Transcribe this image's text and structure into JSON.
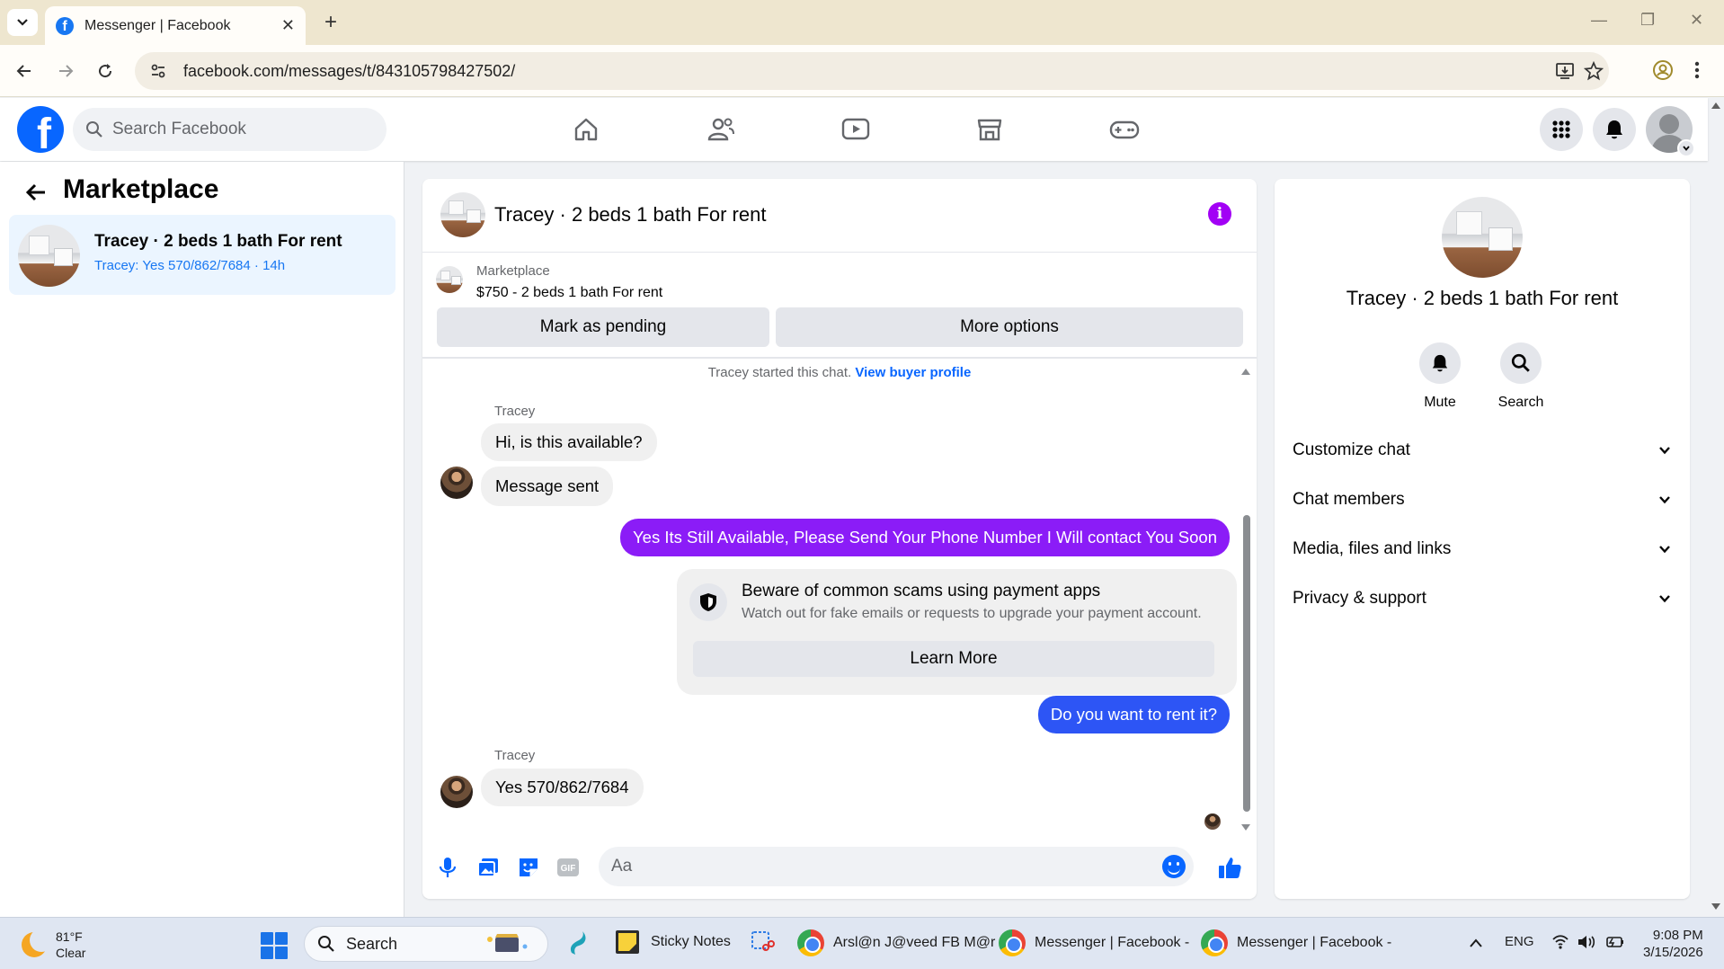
{
  "browser": {
    "tab_title": "Messenger | Facebook",
    "url": "facebook.com/messages/t/843105798427502/"
  },
  "fb_nav": {
    "search_placeholder": "Search Facebook"
  },
  "sidebar": {
    "title": "Marketplace",
    "conversation": {
      "title": "Tracey · 2 beds 1 bath For rent",
      "preview": "Tracey: Yes 570/862/7684 · 14h"
    }
  },
  "chat": {
    "title": "Tracey · 2 beds 1 bath For rent",
    "marketplace_label": "Marketplace",
    "listing_price": "$750 - 2 beds 1 bath For rent",
    "mark_pending_label": "Mark as pending",
    "more_options_label": "More options",
    "started_text": "Tracey started this chat.",
    "view_profile_label": "View buyer profile",
    "messages": [
      {
        "sender": "Tracey",
        "text": "Hi, is this available?"
      },
      {
        "text": "Message sent"
      },
      {
        "text": "Yes Its Still Available, Please Send Your Phone Number I Will contact You Soon"
      },
      {
        "text": "Do you want to rent it?"
      },
      {
        "sender": "Tracey",
        "text": "Yes 570/862/7684"
      }
    ],
    "scam_warning": {
      "title": "Beware of common scams using payment apps",
      "text": "Watch out for fake emails or requests to upgrade your payment account.",
      "button": "Learn More"
    },
    "composer_placeholder": "Aa",
    "gif_label": "GIF"
  },
  "info_panel": {
    "title": "Tracey · 2 beds 1 bath For rent",
    "actions": [
      {
        "label": "Mute",
        "icon": "bell-icon"
      },
      {
        "label": "Search",
        "icon": "search-icon"
      }
    ],
    "sections": [
      "Customize chat",
      "Chat members",
      "Media, files and links",
      "Privacy & support"
    ]
  },
  "taskbar": {
    "weather_temp": "81°F",
    "weather_cond": "Clear",
    "search_label": "Search",
    "apps": [
      "Sticky Notes",
      "Arsl@n J@veed FB M@r",
      "Messenger | Facebook -",
      "Messenger | Facebook -"
    ],
    "language": "ENG",
    "time": "9:08 PM",
    "date": "3/15/2026"
  },
  "colors": {
    "fb_blue": "#0866ff",
    "outgoing_purple": "#8b1cf7",
    "outgoing_blue": "#2d55f5",
    "info_purple": "#a200f5"
  }
}
